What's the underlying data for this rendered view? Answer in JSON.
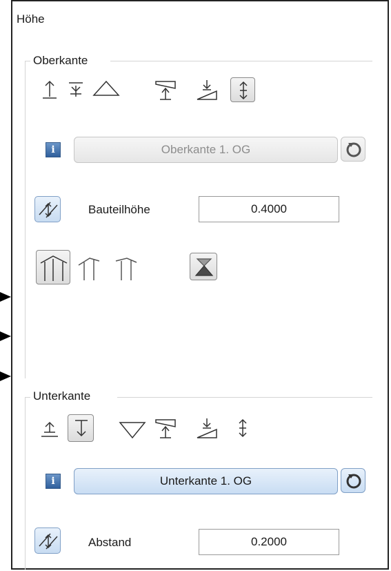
{
  "panel": {
    "title": "Höhe"
  },
  "oberkante": {
    "group_label": "Oberkante",
    "icons": [
      "top-edge-up-icon",
      "top-edge-down-icon",
      "triangle-up-icon",
      "plane-arrow-icon",
      "slope-arrow-icon",
      "vertical-double-arrow-icon"
    ],
    "selected_icon": "vertical-double-arrow-icon",
    "reference_button": "Oberkante 1. OG",
    "reference_enabled": false,
    "height_label": "Bauteilhöhe",
    "height_value": "0.4000",
    "profile_icons": [
      "roof-profile-full-icon",
      "roof-profile-left-icon",
      "roof-profile-right-icon",
      "hourglass-icon"
    ],
    "selected_profile": "roof-profile-full-icon"
  },
  "unterkante": {
    "group_label": "Unterkante",
    "icons": [
      "bottom-edge-up-icon",
      "bottom-edge-down-icon",
      "triangle-down-icon",
      "plane-arrow-icon",
      "slope-arrow-icon",
      "vertical-double-arrow-icon"
    ],
    "selected_icon": "bottom-edge-down-icon",
    "reference_button": "Unterkante 1. OG",
    "reference_enabled": true,
    "distance_label": "Abstand",
    "distance_value": "0.2000"
  },
  "colors": {
    "accent": "#7f9fc6",
    "accent_fill": "#c9ddf3",
    "info": "#2f5f9c",
    "frame": "#222222"
  }
}
